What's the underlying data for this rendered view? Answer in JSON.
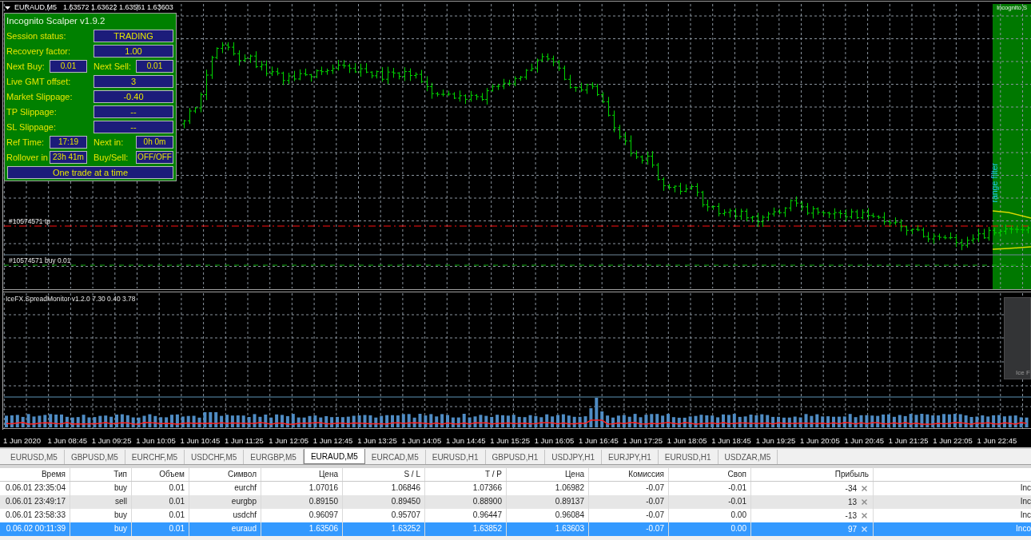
{
  "chart_window": {
    "symbol": "EURAUD,M5",
    "quote": "1.63572 1.63622 1.63561 1.63603"
  },
  "expert_panel": {
    "title": "Incognito Scalper v1.9.2",
    "rows": [
      {
        "kind": "single",
        "label": "Session status:",
        "value": "TRADING"
      },
      {
        "kind": "single",
        "label": "Recovery factor:",
        "value": "1.00"
      },
      {
        "kind": "pair",
        "label": "Next Buy:",
        "value": "0.01",
        "label_2": "Next Sell:",
        "value_2": "0.01"
      },
      {
        "kind": "single",
        "label": "Live GMT offset:",
        "value": "3"
      },
      {
        "kind": "single",
        "label": "Market Slippage:",
        "value": "-0.40"
      },
      {
        "kind": "single",
        "label": "TP Slippage:",
        "value": "--"
      },
      {
        "kind": "single",
        "label": "SL Slippage:",
        "value": "--"
      },
      {
        "kind": "pair",
        "label": "Ref Time:",
        "value": "17:19",
        "label_2": "Next in:",
        "value_2": "0h 0m"
      },
      {
        "kind": "pair",
        "label": "Rollover in",
        "value": "23h 41m",
        "label_2": "Buy/Sell:",
        "value_2": "OFF/OFF"
      },
      {
        "kind": "banner",
        "value": "One trade at a time"
      }
    ]
  },
  "order_lines": [
    {
      "kind": "take_profit",
      "label": "#10574571 tp"
    },
    {
      "kind": "open",
      "label": "#10574571 buy 0.01"
    }
  ],
  "range_zone": {
    "caption": "Incognito S",
    "label": "range filter"
  },
  "indicator": {
    "label": "IceFX.SpreadMonitor v1.2.0 7.30 0.40 3.78",
    "logo_text": "Ice F"
  },
  "time_axis": [
    "1 Jun 2020",
    "1 Jun 08:45",
    "1 Jun 09:25",
    "1 Jun 10:05",
    "1 Jun 10:45",
    "1 Jun 11:25",
    "1 Jun 12:05",
    "1 Jun 12:45",
    "1 Jun 13:25",
    "1 Jun 14:05",
    "1 Jun 14:45",
    "1 Jun 15:25",
    "1 Jun 16:05",
    "1 Jun 16:45",
    "1 Jun 17:25",
    "1 Jun 18:05",
    "1 Jun 18:45",
    "1 Jun 19:25",
    "1 Jun 20:05",
    "1 Jun 20:45",
    "1 Jun 21:25",
    "1 Jun 22:05",
    "1 Jun 22:45"
  ],
  "tabs": [
    {
      "label": "EURUSD,M5",
      "selected": false
    },
    {
      "label": "GBPUSD,M5",
      "selected": false
    },
    {
      "label": "EURCHF,M5",
      "selected": false
    },
    {
      "label": "USDCHF,M5",
      "selected": false
    },
    {
      "label": "EURGBP,M5",
      "selected": false
    },
    {
      "label": "EURAUD,M5",
      "selected": true
    },
    {
      "label": "EURCAD,M5",
      "selected": false
    },
    {
      "label": "EURUSD,H1",
      "selected": false
    },
    {
      "label": "GBPUSD,H1",
      "selected": false
    },
    {
      "label": "USDJPY,H1",
      "selected": false
    },
    {
      "label": "EURJPY,H1",
      "selected": false
    },
    {
      "label": "EURUSD,H1",
      "selected": false
    },
    {
      "label": "USDZAR,M5",
      "selected": false
    }
  ],
  "table": {
    "columns": [
      "Время",
      "Тип",
      "Объем",
      "Символ",
      "Цена",
      "S / L",
      "T / P",
      "Цена",
      "Комиссия",
      "Своп",
      "Прибыль"
    ],
    "rows": [
      {
        "cells": [
          "0.06.01 23:35:04",
          "buy",
          "0.01",
          "eurchf",
          "1.07016",
          "1.06846",
          "1.07366",
          "1.06982",
          "-0.07",
          "-0.01",
          "-34"
        ],
        "column_12": "Inc",
        "selected": false
      },
      {
        "cells": [
          "0.06.01 23:49:17",
          "sell",
          "0.01",
          "eurgbp",
          "0.89150",
          "0.89450",
          "0.88900",
          "0.89137",
          "-0.07",
          "-0.01",
          "13"
        ],
        "column_12": "Inc",
        "selected": false
      },
      {
        "cells": [
          "0.06.01 23:58:33",
          "buy",
          "0.01",
          "usdchf",
          "0.96097",
          "0.95707",
          "0.96447",
          "0.96084",
          "-0.07",
          "0.00",
          "-13"
        ],
        "column_12": "Inc",
        "selected": false
      },
      {
        "cells": [
          "0.06.02 00:11:39",
          "buy",
          "0.01",
          "euraud",
          "1.63506",
          "1.63252",
          "1.63852",
          "1.63603",
          "-0.07",
          "0.00",
          "97"
        ],
        "column_12": "Inco",
        "selected": true
      }
    ]
  }
}
